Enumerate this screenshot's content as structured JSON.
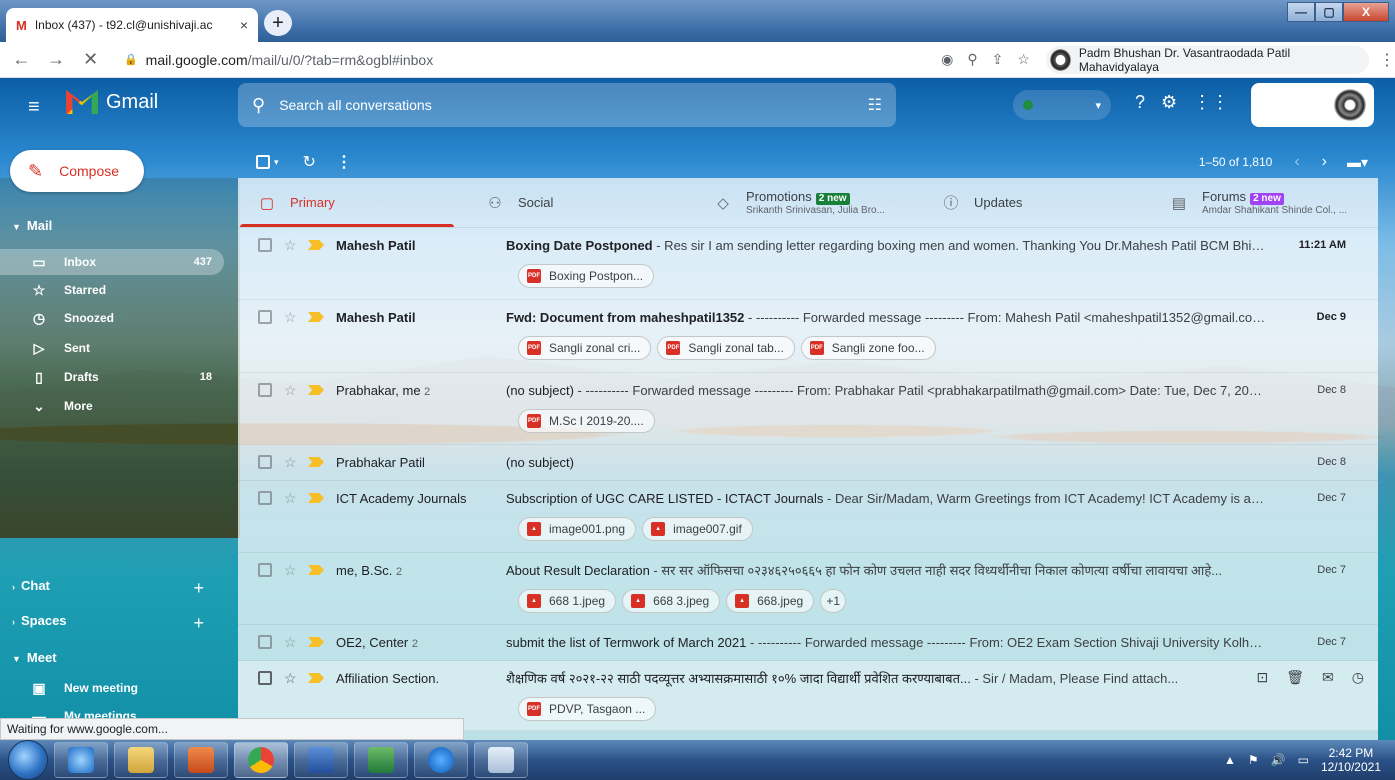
{
  "browser": {
    "tab_title": "Inbox (437) - t92.cl@unishivaji.ac",
    "tab_close": "×",
    "new_tab": "+",
    "url_host": "mail.google.com",
    "url_path": "/mail/u/0/?tab=rm&ogbl#inbox",
    "profile_name": "Padm Bhushan Dr. Vasantraodada Patil Mahavidyalaya",
    "window_buttons": [
      "—",
      "▢",
      "X"
    ]
  },
  "gmail": {
    "logo_text": "Gmail",
    "search_placeholder": "Search all conversations",
    "compose_label": "Compose",
    "nav": {
      "mail_section": "Mail",
      "items": [
        {
          "label": "Inbox",
          "count": "437",
          "icon": "inbox-icon"
        },
        {
          "label": "Starred",
          "count": "",
          "icon": "star-icon"
        },
        {
          "label": "Snoozed",
          "count": "",
          "icon": "clock-icon"
        },
        {
          "label": "Sent",
          "count": "",
          "icon": "send-icon"
        },
        {
          "label": "Drafts",
          "count": "18",
          "icon": "draft-icon"
        },
        {
          "label": "More",
          "count": "",
          "icon": "chevron-down-icon"
        }
      ],
      "chat_section": "Chat",
      "spaces_section": "Spaces",
      "meet_section": "Meet",
      "meet_items": [
        "New meeting",
        "My meetings"
      ]
    },
    "toolbar": {
      "pagination": "1–50 of 1,810"
    },
    "tabs": [
      {
        "label": "Primary",
        "sub": "",
        "badge": "",
        "icon": "inbox-icon"
      },
      {
        "label": "Social",
        "sub": "",
        "badge": "",
        "icon": "people-icon"
      },
      {
        "label": "Promotions",
        "sub": "Srikanth Srinivasan, Julia Bro...",
        "badge": "2 new",
        "badge_color": "#188038",
        "icon": "tag-icon"
      },
      {
        "label": "Updates",
        "sub": "",
        "badge": "",
        "icon": "info-icon"
      },
      {
        "label": "Forums",
        "sub": "Amdar Shahikant Shinde Col., ...",
        "badge": "2 new",
        "badge_color": "#a142f4",
        "icon": "forum-icon"
      }
    ],
    "emails": [
      {
        "sender": "Mahesh Patil",
        "count": "",
        "subject": "Boxing Date Postponed",
        "snippet": " - Res sir I am sending letter regarding boxing men and women. Thanking You Dr.Mahesh Patil BCM Bhila...",
        "date": "11:21 AM",
        "unread": true,
        "attachments": [
          {
            "name": "Boxing Postpon...",
            "type": "pdf"
          }
        ]
      },
      {
        "sender": "Mahesh Patil",
        "count": "",
        "subject": "Fwd: Document from maheshpatil1352",
        "snippet": " - ---------- Forwarded message --------- From: Mahesh Patil <maheshpatil1352@gmail.com> ...",
        "date": "Dec 9",
        "unread": true,
        "attachments": [
          {
            "name": "Sangli zonal cri...",
            "type": "pdf"
          },
          {
            "name": "Sangli zonal tab...",
            "type": "pdf"
          },
          {
            "name": "Sangli zone foo...",
            "type": "pdf"
          }
        ]
      },
      {
        "sender": "Prabhakar, me",
        "count": "2",
        "subject": "(no subject)",
        "snippet": " - ---------- Forwarded message --------- From: Prabhakar Patil <prabhakarpatilmath@gmail.com> Date: Tue, Dec 7, 2021 ...",
        "date": "Dec 8",
        "unread": false,
        "attachments": [
          {
            "name": "M.Sc I 2019-20....",
            "type": "pdf"
          }
        ]
      },
      {
        "sender": "Prabhakar Patil",
        "count": "",
        "subject": "(no subject)",
        "snippet": "",
        "date": "Dec 8",
        "unread": false,
        "attachments": []
      },
      {
        "sender": "ICT Academy Journals",
        "count": "",
        "subject": "Subscription of UGC CARE LISTED - ICTACT Journals",
        "snippet": " - Dear Sir/Madam, Warm Greetings from ICT Academy! ICT Academy is an i...",
        "date": "Dec 7",
        "unread": false,
        "attachments": [
          {
            "name": "image001.png",
            "type": "img"
          },
          {
            "name": "image007.gif",
            "type": "img"
          }
        ]
      },
      {
        "sender": "me, B.Sc.",
        "count": "2",
        "subject": "About Result Declaration",
        "snippet": " - सर सर ऑफिसचा ०२३४६२५०६६५ हा फोन कोण उचलत नाही सदर विध्यर्थीनीचा निकाल कोणत्या वर्षीचा लावायचा आहे...",
        "date": "Dec 7",
        "unread": false,
        "attachments": [
          {
            "name": "668 1.jpeg",
            "type": "img"
          },
          {
            "name": "668 3.jpeg",
            "type": "img"
          },
          {
            "name": "668.jpeg",
            "type": "img"
          }
        ],
        "more": "+1"
      },
      {
        "sender": "OE2, Center",
        "count": "2",
        "subject": "submit the list of Termwork of March 2021",
        "snippet": " - ---------- Forwarded message --------- From: OE2 Exam Section Shivaji University Kolhap...",
        "date": "Dec 7",
        "unread": false,
        "attachments": []
      },
      {
        "sender": "Affiliation Section.",
        "count": "",
        "subject": "शैक्षणिक वर्ष २०२१-२२ साठी पदव्यूत्तर अभ्यासक्रमासाठी १०% जादा विद्यार्थी प्रवेशित करण्याबाबत...",
        "snippet": " - Sir / Madam, Please Find attach...",
        "date": "",
        "unread": false,
        "attachments": [
          {
            "name": "PDVP, Tasgaon ...",
            "type": "pdf"
          }
        ]
      }
    ]
  },
  "status_text": "Waiting for www.google.com...",
  "taskbar": {
    "time": "2:42 PM",
    "date": "12/10/2021"
  }
}
